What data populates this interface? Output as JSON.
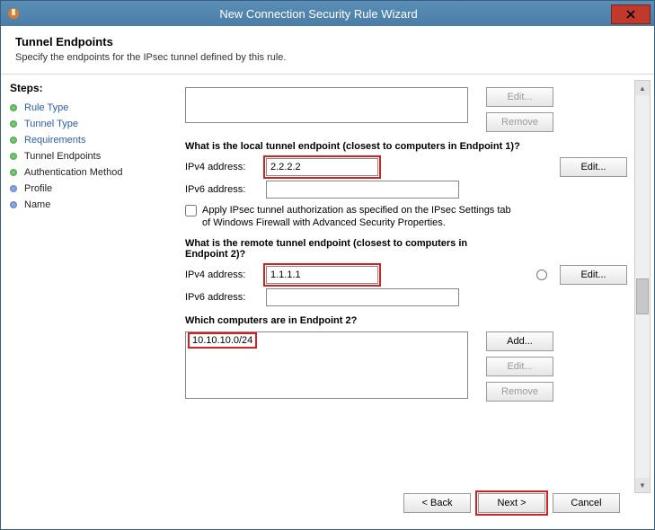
{
  "window": {
    "title": "New Connection Security Rule Wizard"
  },
  "header": {
    "title": "Tunnel Endpoints",
    "subtitle": "Specify the endpoints for the IPsec tunnel defined by this rule."
  },
  "steps": {
    "heading": "Steps:",
    "items": [
      {
        "label": "Rule Type",
        "state": "done"
      },
      {
        "label": "Tunnel Type",
        "state": "done"
      },
      {
        "label": "Requirements",
        "state": "done"
      },
      {
        "label": "Tunnel Endpoints",
        "state": "current"
      },
      {
        "label": "Authentication Method",
        "state": "pending"
      },
      {
        "label": "Profile",
        "state": "pending"
      },
      {
        "label": "Name",
        "state": "pending"
      }
    ]
  },
  "topbox": {
    "edit": "Edit...",
    "remove": "Remove"
  },
  "local": {
    "heading": "What is the local tunnel endpoint (closest to computers in Endpoint 1)?",
    "ipv4_label": "IPv4 address:",
    "ipv4_value": "2.2.2.2",
    "ipv6_label": "IPv6 address:",
    "ipv6_value": "",
    "edit": "Edit...",
    "checkbox_label": "Apply IPsec tunnel authorization as specified on the IPsec Settings tab of Windows Firewall with Advanced Security Properties."
  },
  "remote": {
    "heading": "What is the remote tunnel endpoint (closest to computers in Endpoint 2)?",
    "ipv4_label": "IPv4 address:",
    "ipv4_value": "1.1.1.1",
    "ipv6_label": "IPv6 address:",
    "ipv6_value": "",
    "edit": "Edit..."
  },
  "endpoint2": {
    "heading": "Which computers are in Endpoint 2?",
    "value": "10.10.10.0/24",
    "add": "Add...",
    "edit": "Edit...",
    "remove": "Remove"
  },
  "nav": {
    "back": "< Back",
    "next": "Next >",
    "cancel": "Cancel"
  }
}
